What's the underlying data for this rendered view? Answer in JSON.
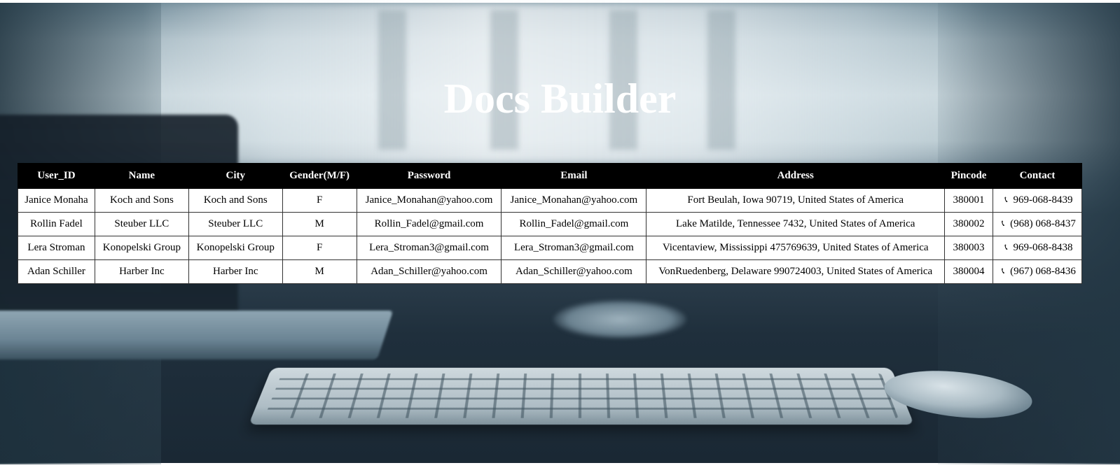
{
  "page": {
    "title": "Docs Builder"
  },
  "table": {
    "headers": [
      "User_ID",
      "Name",
      "City",
      "Gender(M/F)",
      "Password",
      "Email",
      "Address",
      "Pincode",
      "Contact"
    ],
    "rows": [
      {
        "user_id": "Janice Monaha",
        "name": "Koch and Sons",
        "city": "Koch and Sons",
        "gender": "F",
        "password": "Janice_Monahan@yahoo.com",
        "email": "Janice_Monahan@yahoo.com",
        "address": "Fort Beulah, Iowa 90719, United States of America",
        "pincode": "380001",
        "contact": "969-068-8439"
      },
      {
        "user_id": "Rollin Fadel",
        "name": "Steuber LLC",
        "city": "Steuber LLC",
        "gender": "M",
        "password": "Rollin_Fadel@gmail.com",
        "email": "Rollin_Fadel@gmail.com",
        "address": "Lake Matilde, Tennessee 7432, United States of America",
        "pincode": "380002",
        "contact": "(968) 068-8437"
      },
      {
        "user_id": "Lera Stroman",
        "name": "Konopelski Group",
        "city": "Konopelski Group",
        "gender": "F",
        "password": "Lera_Stroman3@gmail.com",
        "email": "Lera_Stroman3@gmail.com",
        "address": "Vicentaview, Mississippi 475769639, United States of America",
        "pincode": "380003",
        "contact": "969-068-8438"
      },
      {
        "user_id": "Adan Schiller",
        "name": "Harber Inc",
        "city": "Harber Inc",
        "gender": "M",
        "password": "Adan_Schiller@yahoo.com",
        "email": "Adan_Schiller@yahoo.com",
        "address": "VonRuedenberg, Delaware 990724003, United States of America",
        "pincode": "380004",
        "contact": "(967) 068-8436"
      }
    ],
    "contact_icon": "phone-icon"
  },
  "colors": {
    "header_bg": "#000000",
    "header_text": "#ffffff",
    "cell_bg": "#ffffff",
    "title_text": "#ffffff"
  }
}
